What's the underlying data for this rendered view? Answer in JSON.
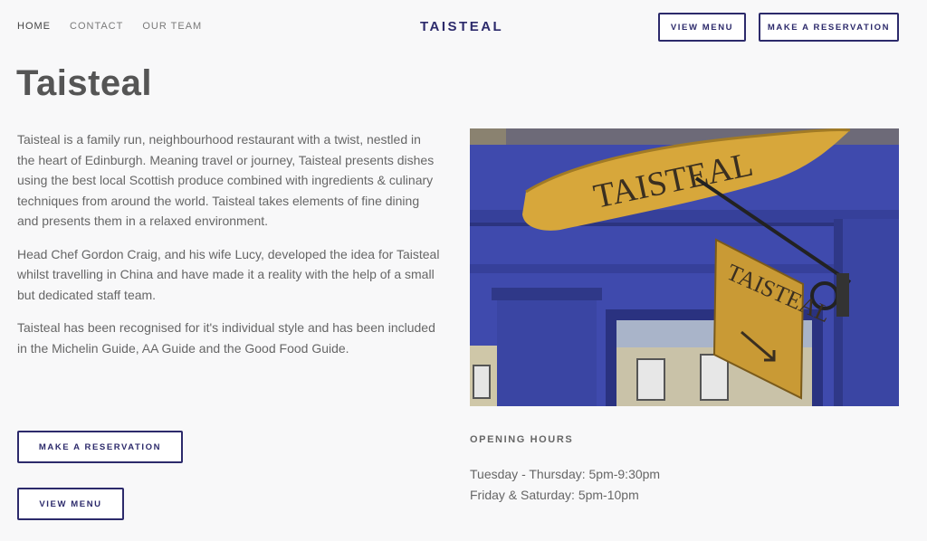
{
  "nav": {
    "items": [
      {
        "label": "HOME",
        "active": true
      },
      {
        "label": "CONTACT",
        "active": false
      },
      {
        "label": "OUR TEAM",
        "active": false
      }
    ]
  },
  "brand": "TAISTEAL",
  "header_buttons": {
    "view_menu": "VIEW MENU",
    "reservation": "MAKE A RESERVATION"
  },
  "title": "Taisteal",
  "body": {
    "paragraphs": [
      "Taisteal is a family run, neighbourhood restaurant with a twist, nestled in the heart of Edinburgh.  Meaning travel or journey, Taisteal presents dishes using the best local Scottish produce combined with ingredients & culinary techniques from around the world. Taisteal takes elements of fine dining and presents them in a relaxed environment.",
      "Head Chef Gordon Craig, and his wife Lucy, developed the idea for Taisteal whilst travelling in China and have made it a reality with the help of a small but dedicated staff team.",
      "Taisteal has been recognised for it's individual style and has been included in the Michelin Guide, AA Guide and the Good Food Guide."
    ]
  },
  "cta": {
    "reservation": "MAKE A RESERVATION",
    "view_menu": "VIEW MENU"
  },
  "photo": {
    "sign_main": "TAISTEAL",
    "sign_hanging": "TAISTEAL",
    "colors": {
      "facade": "#3d49a8",
      "sign_wood": "#d7a73b"
    }
  },
  "hours": {
    "heading": "OPENING HOURS",
    "lines": [
      "Tuesday - Thursday: 5pm-9:30pm",
      "Friday & Saturday: 5pm-10pm"
    ]
  },
  "colors": {
    "accent": "#2c2a6b",
    "background": "#f8f8f9",
    "text": "#666666"
  }
}
